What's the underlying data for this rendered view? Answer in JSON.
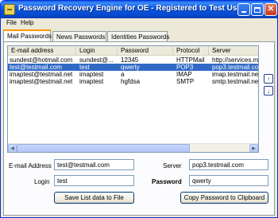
{
  "window": {
    "title": "Password Recovery Engine for OE - Registered to Test User",
    "controls": {
      "minimize": "minimize",
      "maximize": "maximize",
      "close": "✕"
    }
  },
  "menu": {
    "file": "File",
    "help": "Help"
  },
  "tabs": [
    {
      "label": "Mail Passwords",
      "active": true
    },
    {
      "label": "News Passwords",
      "active": false
    },
    {
      "label": "Identities Passwords",
      "active": false
    }
  ],
  "list": {
    "columns": [
      "E-mail address",
      "Login",
      "Password",
      "Protocol",
      "Server"
    ],
    "rows": [
      {
        "cells": [
          "sundest@hotmail.com",
          "sundest@...",
          "12345",
          "HTTPMail",
          "http://services.m..."
        ],
        "selected": false
      },
      {
        "cells": [
          "test@testmail.com",
          "test",
          "qwerty",
          "POP3",
          "pop3.testmail.com"
        ],
        "selected": true
      },
      {
        "cells": [
          "imaptest@testmail.net",
          "imaptest",
          "a",
          "IMAP",
          "imap.testmail.net"
        ],
        "selected": false
      },
      {
        "cells": [
          "imaptest@testmail.net",
          "imaptest",
          "hgfdsa",
          "SMTP",
          "smtp.testmail.net"
        ],
        "selected": false
      }
    ]
  },
  "side_buttons": {
    "up": "↑",
    "down": "↓"
  },
  "scroll_arrows": {
    "left": "◀",
    "right": "▶"
  },
  "details": {
    "email_label": "E-mail Address",
    "email_value": "test@testmail.com",
    "login_label": "Login",
    "login_value": "test",
    "server_label": "Server",
    "server_value": "pop3.testmail.com",
    "password_label": "Password",
    "password_value": "qwerty"
  },
  "buttons": {
    "save_list": "Save List data to File",
    "copy_password": "Copy Password to Clipboard"
  },
  "colors": {
    "selection": "#316ac5",
    "titlebar": "#0a5ae6",
    "tab_accent": "#ff9900"
  }
}
